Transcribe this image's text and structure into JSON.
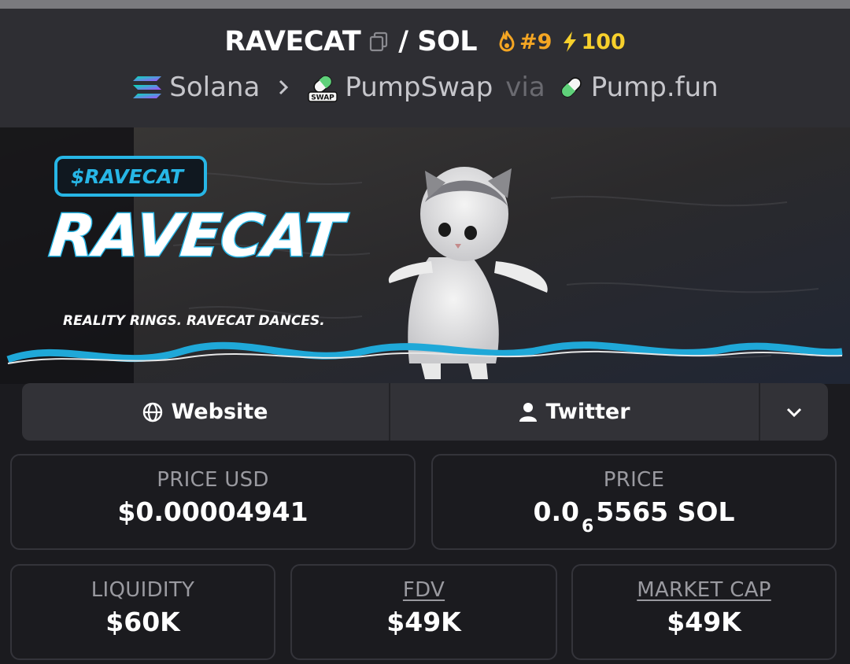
{
  "header": {
    "base_symbol": "RAVECAT",
    "quote_symbol": "/ SOL",
    "rank": "#9",
    "boost": "100",
    "chain": "Solana",
    "dex": "PumpSwap",
    "via": "via",
    "launchpad": "Pump.fun",
    "swap_badge": "SWAP",
    "icons": {
      "copy": "copy-icon",
      "rank": "flame-icon",
      "boost": "lightning-icon",
      "chain": "solana-logo-icon",
      "separator": "chevron-right-icon",
      "dex": "pumpswap-pill-icon",
      "launchpad": "pumpfun-pill-icon"
    },
    "colors": {
      "rank": "#f5a623",
      "boost": "#f7d02c"
    }
  },
  "banner": {
    "ticker_tag": "$RAVECAT",
    "title": "RAVECAT",
    "tagline": "REALITY RINGS. RAVECAT DANCES."
  },
  "links": {
    "website": "Website",
    "twitter": "Twitter",
    "icons": {
      "website": "globe-icon",
      "twitter": "user-icon",
      "more": "chevron-down-icon"
    }
  },
  "stats": {
    "price_usd": {
      "label": "PRICE USD",
      "value": "$0.00004941"
    },
    "price": {
      "label": "PRICE",
      "value_prefix": "0.0",
      "value_sub": "6",
      "value_suffix": "5565 SOL"
    },
    "liquidity": {
      "label": "LIQUIDITY",
      "value": "$60K"
    },
    "fdv": {
      "label": "FDV",
      "value": "$49K"
    },
    "market_cap": {
      "label": "MARKET CAP",
      "value": "$49K"
    }
  }
}
